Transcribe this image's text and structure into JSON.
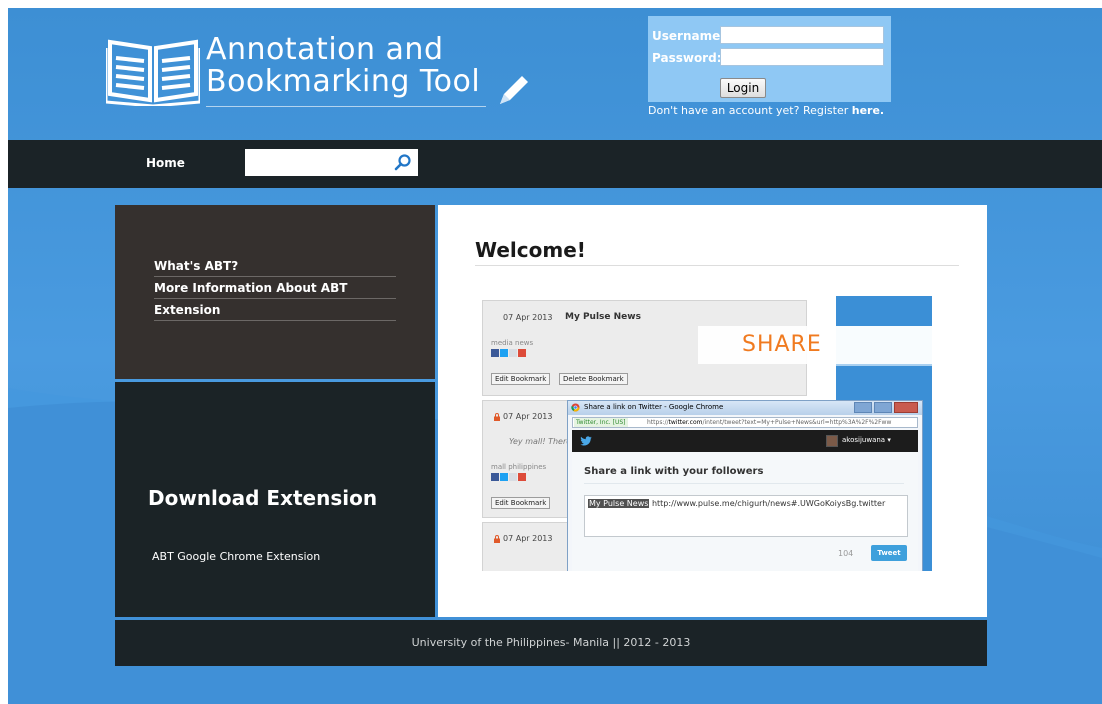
{
  "header": {
    "logo_title": "Annotation and\nBookmarking Tool"
  },
  "login": {
    "username_label": "Username:",
    "password_label": "Password:",
    "username_value": "",
    "password_value": "",
    "login_button": "Login",
    "register_prefix": "Don't have an account yet? Register",
    "register_link": "here."
  },
  "nav": {
    "home": "Home",
    "search_value": ""
  },
  "sidebar": {
    "links": [
      "What's ABT?",
      "More Information About ABT",
      "Extension"
    ],
    "download_title": "Download Extension",
    "download_link": "ABT Google Chrome Extension"
  },
  "main": {
    "welcome": "Welcome!"
  },
  "screenshot": {
    "cards": [
      {
        "date": "07 Apr 2013",
        "title": "My Pulse News",
        "tags": "media news",
        "edit": "Edit Bookmark",
        "delete": "Delete Bookmark"
      },
      {
        "date": "07 Apr 2013",
        "snippet": "Yey mall! There's",
        "tags": "mall philippines",
        "edit": "Edit Bookmark"
      },
      {
        "date": "07 Apr 2013"
      }
    ],
    "share_banner": "SHARE",
    "popup": {
      "window_title": "Share a link on Twitter - Google Chrome",
      "secure_label": "Twitter, Inc. [US]",
      "url_scheme": "https://",
      "url_host": "twitter.com",
      "url_path": "/intent/tweet?text=My+Pulse+News&url=http%3A%2F%2Fww",
      "username": "akosijuwana ▾",
      "heading": "Share a link with your followers",
      "text_highlight": "My Pulse News",
      "text_rest": " http://www.pulse.me/chigurh/news#.UWGoKoiysBg.twitter",
      "char_count": "104",
      "tweet_button": "Tweet"
    }
  },
  "footer": {
    "text": "University of the Philippines- Manila || 2012 - 2013"
  },
  "colors": {
    "page_blue": "#4a9be0",
    "dark_bar": "#1b2327",
    "sidebar_top": "#35302e",
    "share_orange": "#f07a1f",
    "twitter_blue": "#3ea0dc"
  }
}
